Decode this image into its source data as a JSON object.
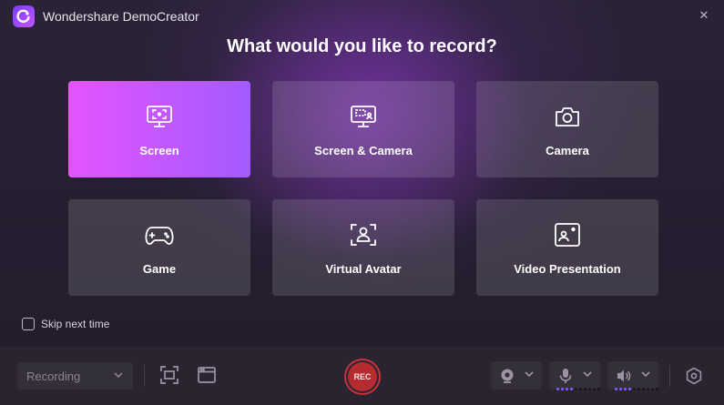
{
  "window": {
    "title": "Wondershare DemoCreator",
    "close_icon": "close-icon"
  },
  "heading": "What would you like to record?",
  "options": [
    {
      "label": "Screen",
      "icon": "screen-icon",
      "selected": true
    },
    {
      "label": "Screen & Camera",
      "icon": "screen-camera-icon",
      "selected": false
    },
    {
      "label": "Camera",
      "icon": "camera-icon",
      "selected": false
    },
    {
      "label": "Game",
      "icon": "gamepad-icon",
      "selected": false
    },
    {
      "label": "Virtual Avatar",
      "icon": "avatar-icon",
      "selected": false
    },
    {
      "label": "Video Presentation",
      "icon": "presentation-icon",
      "selected": false
    }
  ],
  "skip": {
    "label": "Skip next time",
    "checked": false
  },
  "bottom": {
    "mode_select": {
      "value": "Recording"
    },
    "rec_label": "REC",
    "colors": {
      "accent": "#c455ff",
      "rec": "#b62b30",
      "card_active_start": "#e454ff",
      "card_active_end": "#a35bff"
    }
  }
}
